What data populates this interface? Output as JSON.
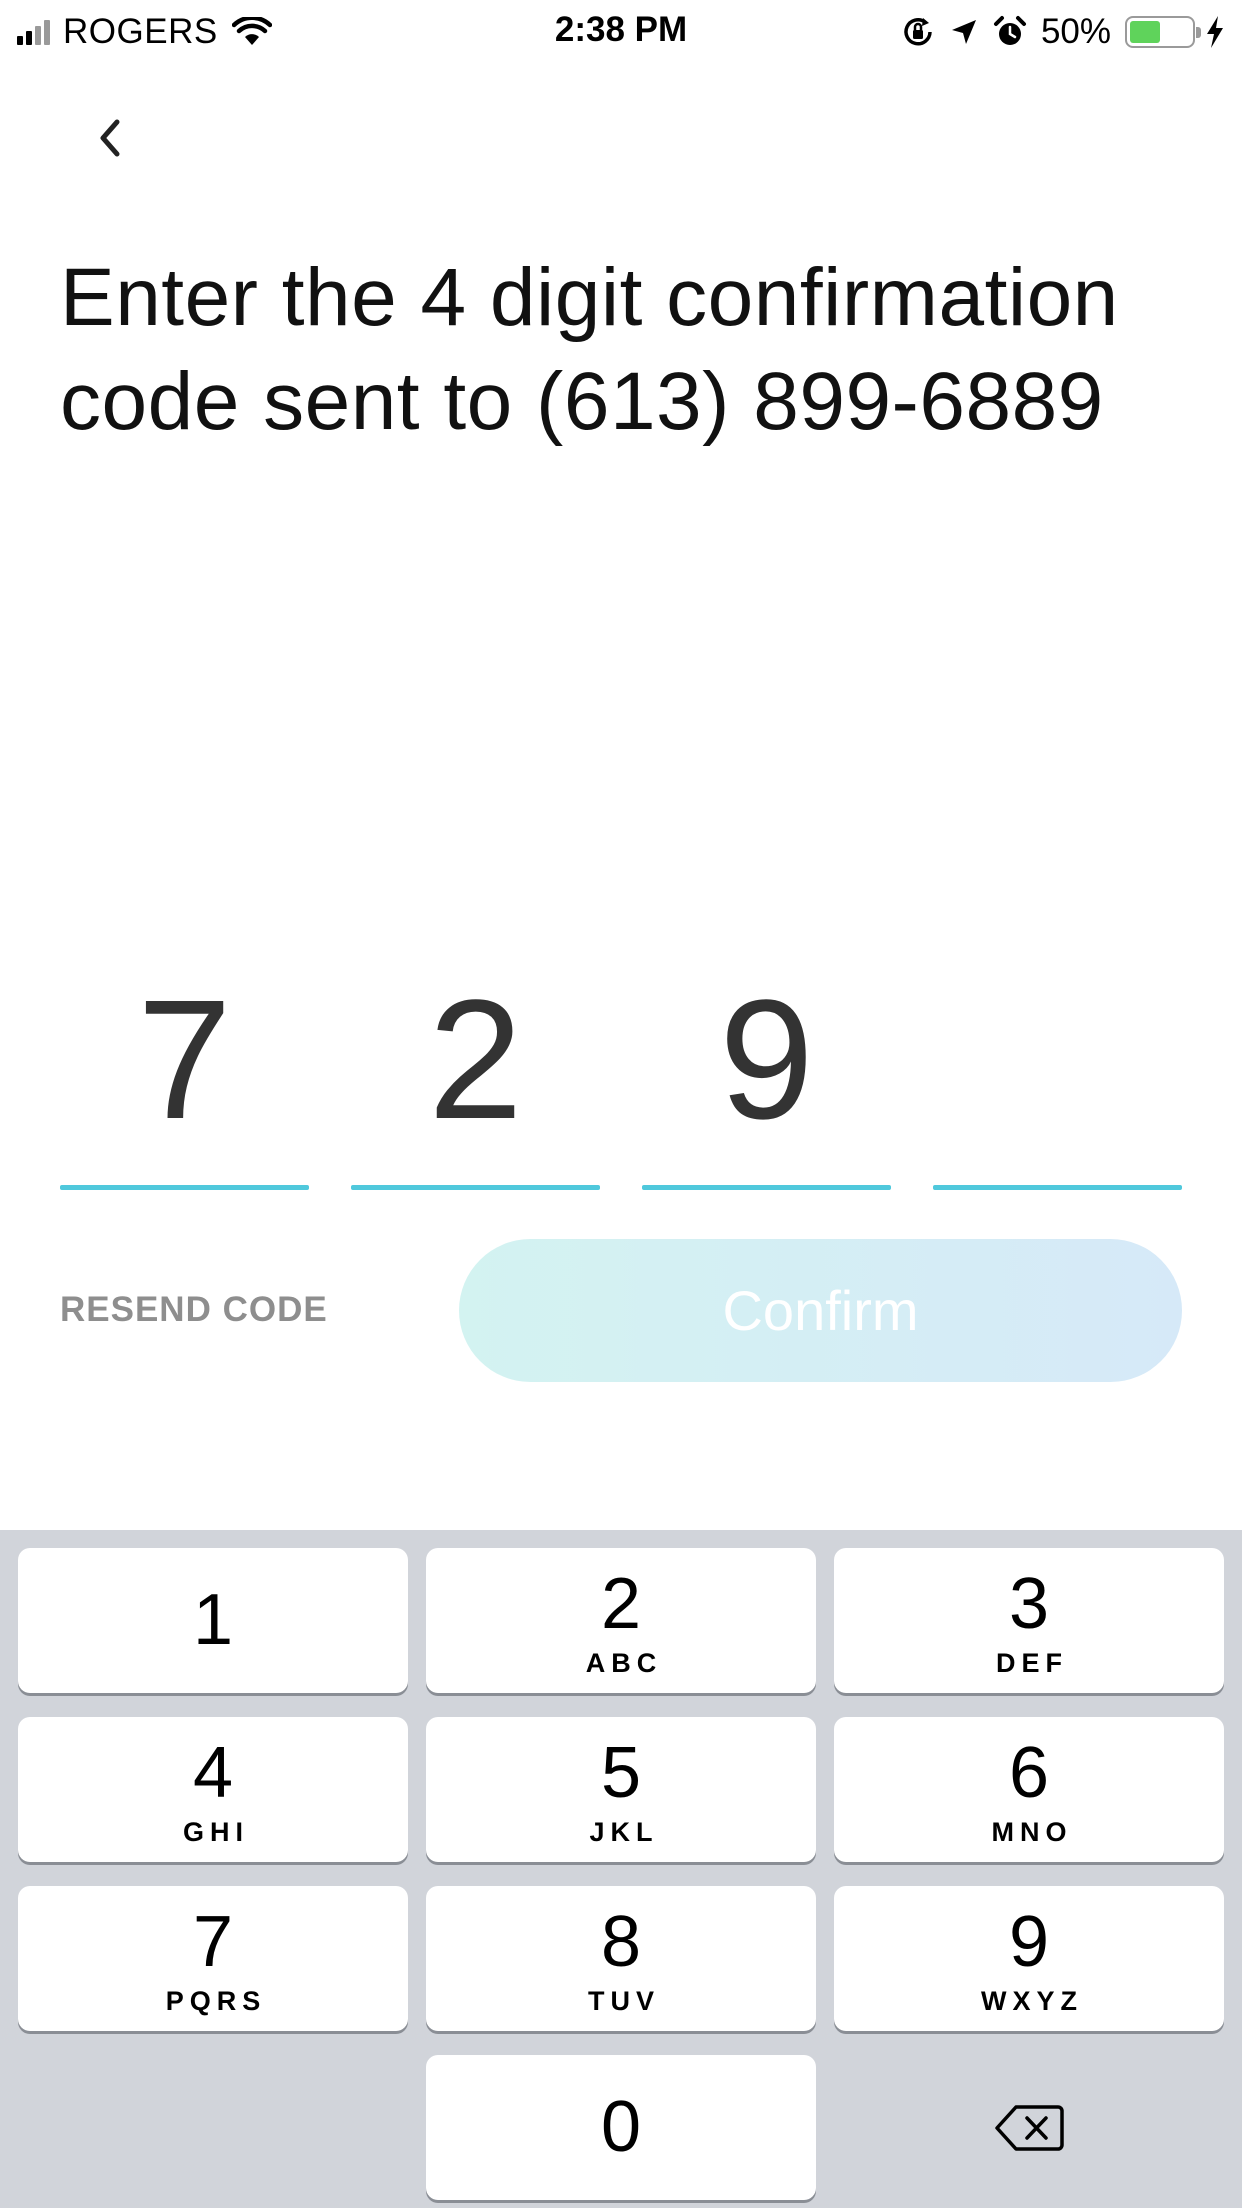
{
  "status_bar": {
    "carrier": "ROGERS",
    "time": "2:38 PM",
    "battery_percent": "50%",
    "battery_level": 0.5,
    "battery_color": "#5fd35b",
    "icons": [
      "signal-icon",
      "wifi-icon",
      "orientation-lock-icon",
      "location-arrow-icon",
      "alarm-icon",
      "battery-icon",
      "charging-bolt-icon"
    ]
  },
  "header": {
    "back_icon": "chevron-left-icon",
    "title": "Enter the 4 digit confirmation code sent to (613) 899-6889"
  },
  "code": {
    "digits": [
      "7",
      "2",
      "9",
      ""
    ],
    "underline_color": "#4fc8dc"
  },
  "actions": {
    "resend_label": "RESEND CODE",
    "confirm_label": "Confirm"
  },
  "keypad": {
    "keys": [
      {
        "num": "1",
        "letters": ""
      },
      {
        "num": "2",
        "letters": "ABC"
      },
      {
        "num": "3",
        "letters": "DEF"
      },
      {
        "num": "4",
        "letters": "GHI"
      },
      {
        "num": "5",
        "letters": "JKL"
      },
      {
        "num": "6",
        "letters": "MNO"
      },
      {
        "num": "7",
        "letters": "PQRS"
      },
      {
        "num": "8",
        "letters": "TUV"
      },
      {
        "num": "9",
        "letters": "WXYZ"
      },
      {
        "num": "0",
        "letters": ""
      }
    ],
    "delete_icon": "backspace-icon"
  }
}
